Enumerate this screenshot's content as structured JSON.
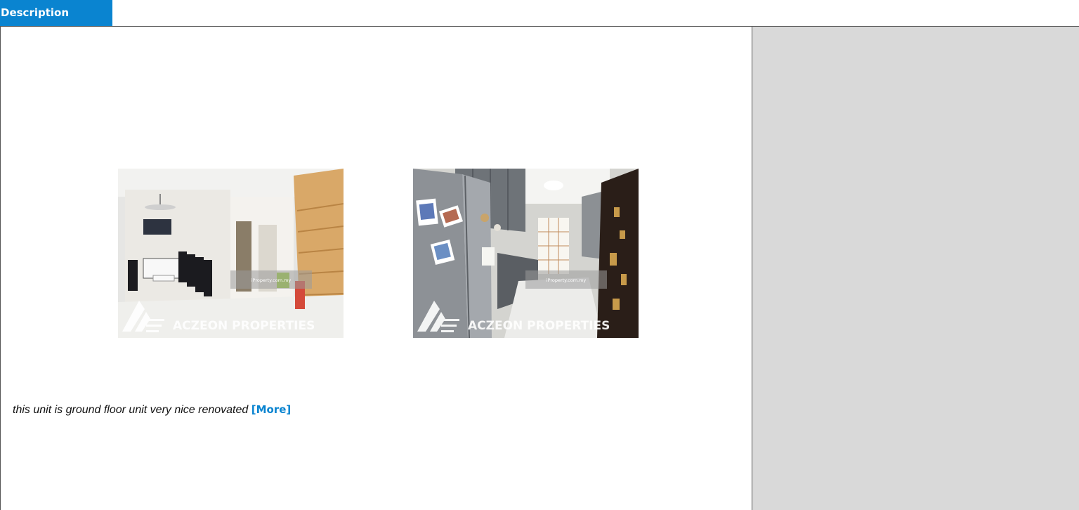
{
  "tab": {
    "label": "Description"
  },
  "photos": [
    {
      "watermark_brand": "ACZEON PROPERTIES",
      "watermark_site": "iProperty.com.my"
    },
    {
      "watermark_brand": "ACZEON PROPERTIES",
      "watermark_site": "iProperty.com.my"
    }
  ],
  "description": {
    "text": "this unit is ground floor unit very nice renovated ",
    "more_label": "[More]"
  },
  "colors": {
    "accent": "#0a84d0",
    "sidebar": "#d9d9d9",
    "border": "#555555"
  }
}
